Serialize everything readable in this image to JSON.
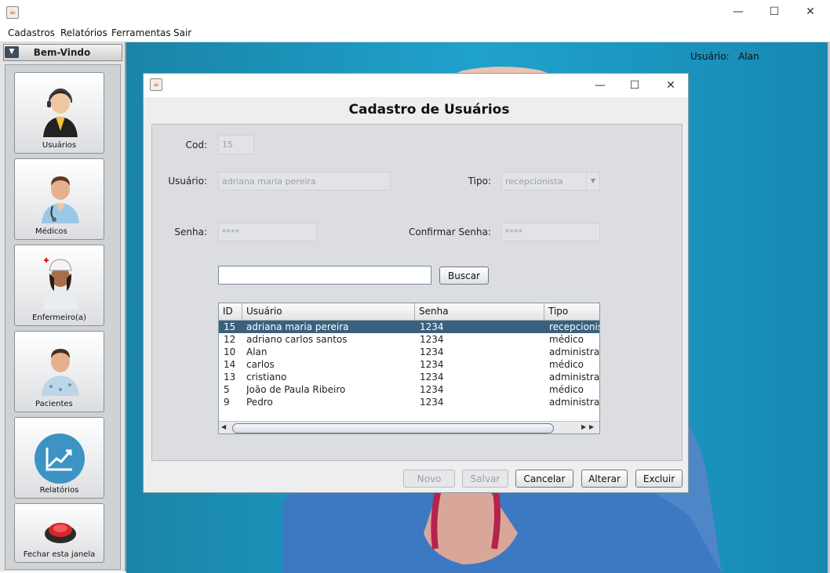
{
  "menu": [
    "Cadastros",
    "Relatórios",
    "Ferramentas",
    "Sair"
  ],
  "left_panel": {
    "title": "Bem-Vindo",
    "items": [
      {
        "label": "Usuários",
        "icon": "receptionist-icon"
      },
      {
        "label": "Médicos",
        "icon": "doctor-icon"
      },
      {
        "label": "Enfermeiro(a)",
        "icon": "nurse-icon"
      },
      {
        "label": "Pacientes",
        "icon": "patient-icon"
      },
      {
        "label": "Relatórios",
        "icon": "chart-icon"
      },
      {
        "label": "Fechar esta janela",
        "icon": "power-button-icon"
      }
    ]
  },
  "session": {
    "user_label": "Usuário:",
    "user_name": "Alan"
  },
  "dialog": {
    "title": "Cadastro de Usuários",
    "labels": {
      "cod": "Cod:",
      "usuario": "Usuário:",
      "tipo": "Tipo:",
      "senha": "Senha:",
      "confirmar": "Confirmar Senha:"
    },
    "values": {
      "cod": "15",
      "usuario": "adriana maria pereira",
      "tipo": "recepcionista",
      "senha": "****",
      "confirmar": "****"
    },
    "search": {
      "value": "",
      "button": "Buscar"
    },
    "table": {
      "columns": [
        "ID",
        "Usuário",
        "Senha",
        "Tipo"
      ],
      "selected_index": 0,
      "rows": [
        [
          "15",
          "adriana maria pereira",
          "1234",
          "recepcionista"
        ],
        [
          "12",
          "adriano carlos santos",
          "1234",
          "médico"
        ],
        [
          "10",
          "Alan",
          "1234",
          "administrador"
        ],
        [
          "14",
          "carlos",
          "1234",
          "médico"
        ],
        [
          "13",
          "cristiano",
          "1234",
          "administrador"
        ],
        [
          "5",
          "João de Paula Ribeiro",
          "1234",
          "médico"
        ],
        [
          "9",
          "Pedro",
          "1234",
          "administrador"
        ]
      ]
    },
    "buttons": {
      "novo": "Novo",
      "salvar": "Salvar",
      "cancelar": "Cancelar",
      "alterar": "Alterar",
      "excluir": "Excluir"
    }
  }
}
